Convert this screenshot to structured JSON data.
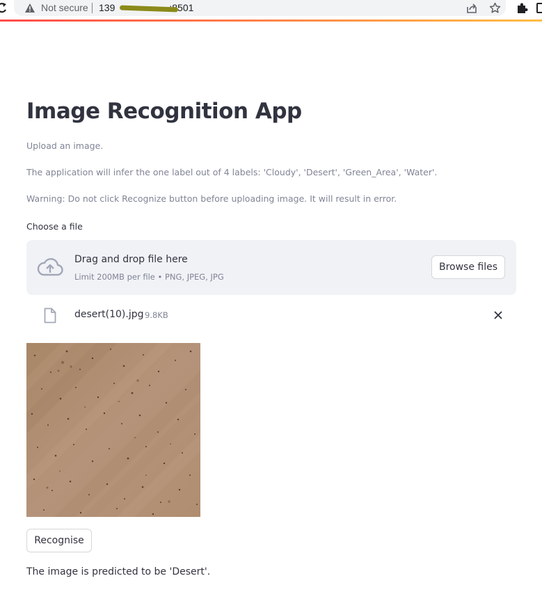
{
  "browser": {
    "security_label": "Not secure",
    "url_start": "139",
    "url_end": ":8501"
  },
  "app": {
    "title": "Image Recognition App",
    "instructions": [
      "Upload an image.",
      "The application will infer the one label out of 4 labels: 'Cloudy', 'Desert', 'Green_Area', 'Water'.",
      "Warning: Do not click Recognize button before uploading image. It will result in error."
    ]
  },
  "uploader": {
    "label": "Choose a file",
    "drop_title": "Drag and drop file here",
    "limit_text": "Limit 200MB per file • PNG, JPEG, JPG",
    "browse_label": "Browse files",
    "icon": "cloud-upload-icon"
  },
  "uploaded_file": {
    "name": "desert(10).jpg",
    "size": "9.8KB",
    "icon": "file-icon"
  },
  "actions": {
    "recognise_label": "Recognise"
  },
  "result": {
    "text": "The image is predicted to be 'Desert'."
  },
  "colors": {
    "accent": "#ff4b4b",
    "text": "#31333f",
    "muted": "#808495",
    "dropzone_bg": "#f0f2f6",
    "sand": "#b08e6f"
  }
}
